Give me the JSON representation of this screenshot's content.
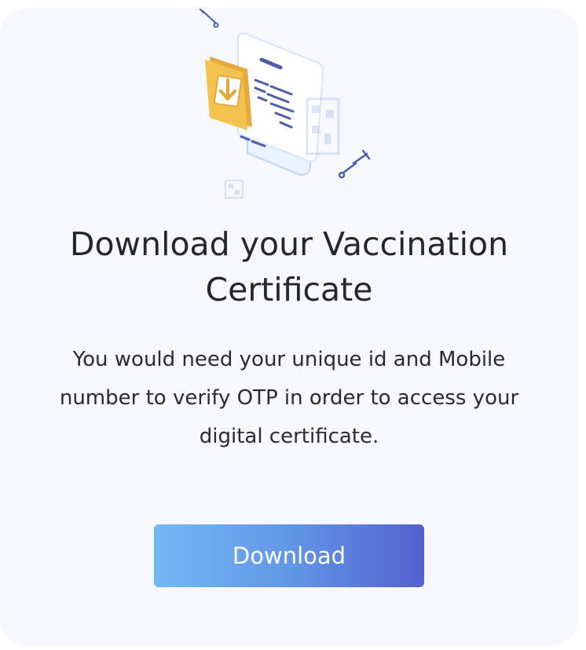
{
  "card": {
    "title": "Download your Vaccination Certificate",
    "description": "You would need your unique id and Mobile number to verify OTP in order to access your digital certificate.",
    "download_label": "Download"
  },
  "illustration": {
    "icon": "certificate-download-illustration",
    "colors": {
      "folder": "#f2c04f",
      "paper": "#ffffff",
      "paper_outline": "#c9dcf5",
      "accent_text": "#4d5ea8",
      "syringe": "#4a5fb0"
    }
  },
  "colors": {
    "card_background": "#f7f8fd",
    "button_gradient_start": "#73b9f3",
    "button_gradient_end": "#5461cf",
    "button_text": "#ffffff",
    "title_text": "#26272b"
  }
}
